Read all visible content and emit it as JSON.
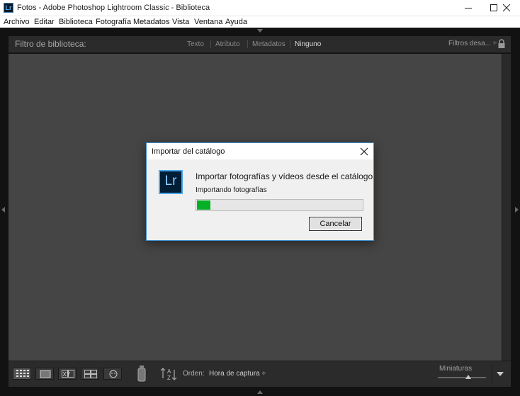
{
  "window": {
    "title": "Fotos - Adobe Photoshop Lightroom Classic - Biblioteca",
    "app_icon_text": "Lr"
  },
  "menu": [
    {
      "label": "Archivo"
    },
    {
      "label": "Editar"
    },
    {
      "label": "Biblioteca"
    },
    {
      "label": "Fotografía"
    },
    {
      "label": "Metadatos"
    },
    {
      "label": "Vista"
    },
    {
      "label": "Ventana"
    },
    {
      "label": "Ayuda"
    }
  ],
  "filter_bar": {
    "title": "Filtro de biblioteca:",
    "options": [
      "Texto",
      "Atributo",
      "Metadatos",
      "Ninguno"
    ],
    "active_option": "Ninguno",
    "preset": "Filtros desa... ÷"
  },
  "toolbar": {
    "sort_label": "Orden:",
    "sort_value": "Hora de captura ÷",
    "thumbnails_label": "Miniaturas",
    "compare_label": "XY"
  },
  "dialog": {
    "title": "Importar del catálogo",
    "heading": "Importar fotografías y vídeos desde el catálogo",
    "status": "Importando fotografías",
    "progress": 0.08,
    "cancel_label": "Cancelar",
    "logo_text": "Lr"
  },
  "colors": {
    "progress_fill": "#06b025",
    "dialog_border": "#3c8ecf",
    "grid_background": "#454545"
  }
}
